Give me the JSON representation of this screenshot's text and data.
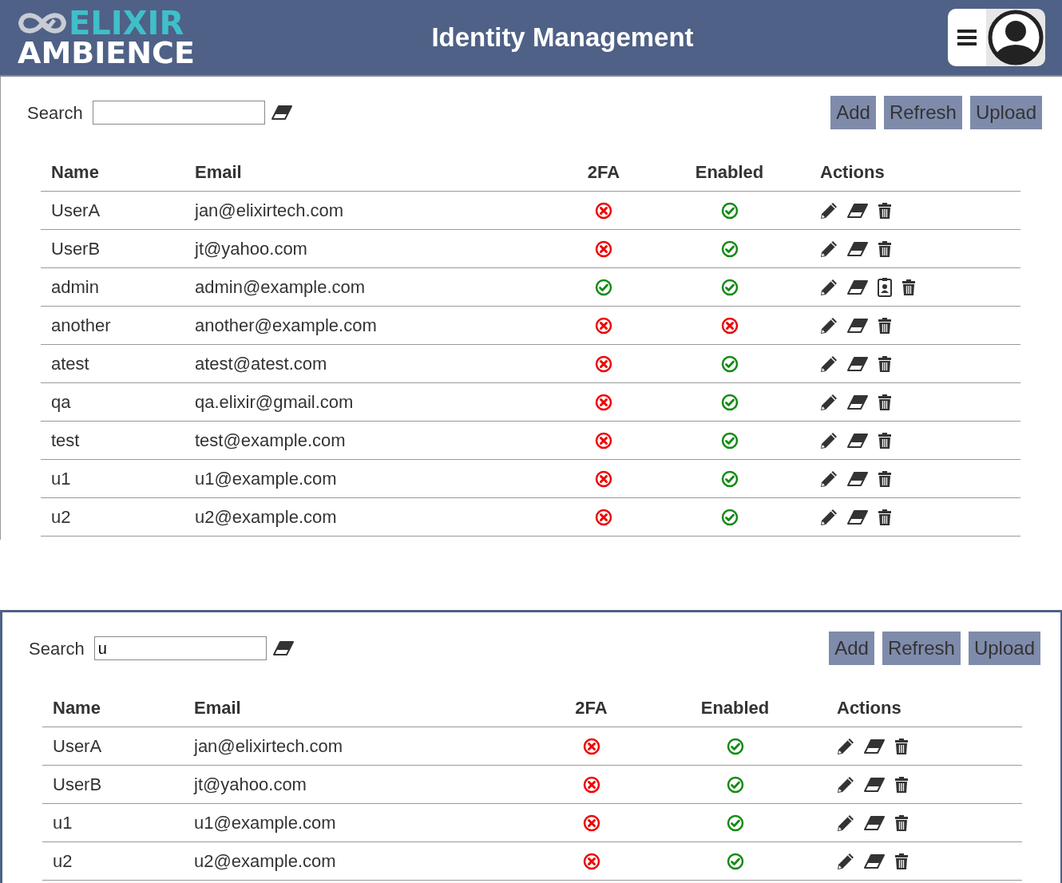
{
  "header": {
    "logo_top": "ELIXIR",
    "logo_bottom": "AMBIENCE",
    "title": "Identity Management"
  },
  "panels": [
    {
      "search": {
        "label": "Search"
      },
      "buttons": [
        "Add",
        "Refresh",
        "Upload"
      ],
      "table": {
        "columns": [
          "Name",
          "Email",
          "2FA",
          "Enabled",
          "Actions"
        ],
        "rows": [
          {
            "name": "UserA",
            "email": "jan@elixirtech.com",
            "twofa": false,
            "enabled": true,
            "actions": [
              {
                "kind": "edit"
              },
              {
                "kind": "erase"
              },
              {
                "kind": "delete"
              }
            ]
          },
          {
            "name": "UserB",
            "email": "jt@yahoo.com",
            "twofa": false,
            "enabled": true,
            "actions": [
              {
                "kind": "edit"
              },
              {
                "kind": "erase"
              },
              {
                "kind": "delete"
              }
            ]
          },
          {
            "name": "admin",
            "email": "admin@example.com",
            "twofa": true,
            "enabled": true,
            "actions": [
              {
                "kind": "edit"
              },
              {
                "kind": "erase"
              },
              {
                "kind": "badge"
              },
              {
                "kind": "delete"
              }
            ]
          },
          {
            "name": "another",
            "email": "another@example.com",
            "twofa": false,
            "enabled": false,
            "actions": [
              {
                "kind": "edit"
              },
              {
                "kind": "erase"
              },
              {
                "kind": "delete"
              }
            ]
          },
          {
            "name": "atest",
            "email": "atest@atest.com",
            "twofa": false,
            "enabled": true,
            "actions": [
              {
                "kind": "edit"
              },
              {
                "kind": "erase"
              },
              {
                "kind": "delete"
              }
            ]
          },
          {
            "name": "qa",
            "email": "qa.elixir@gmail.com",
            "twofa": false,
            "enabled": true,
            "actions": [
              {
                "kind": "edit"
              },
              {
                "kind": "erase"
              },
              {
                "kind": "delete"
              }
            ]
          },
          {
            "name": "test",
            "email": "test@example.com",
            "twofa": false,
            "enabled": true,
            "actions": [
              {
                "kind": "edit"
              },
              {
                "kind": "erase"
              },
              {
                "kind": "delete"
              }
            ]
          },
          {
            "name": "u1",
            "email": "u1@example.com",
            "twofa": false,
            "enabled": true,
            "actions": [
              {
                "kind": "edit"
              },
              {
                "kind": "erase"
              },
              {
                "kind": "delete"
              }
            ]
          },
          {
            "name": "u2",
            "email": "u2@example.com",
            "twofa": false,
            "enabled": true,
            "actions": [
              {
                "kind": "edit"
              },
              {
                "kind": "erase"
              },
              {
                "kind": "delete"
              }
            ]
          }
        ]
      }
    },
    {
      "search": {
        "label": "Search",
        "value": "u"
      },
      "buttons": [
        "Add",
        "Refresh",
        "Upload"
      ],
      "table": {
        "columns": [
          "Name",
          "Email",
          "2FA",
          "Enabled",
          "Actions"
        ],
        "rows": [
          {
            "name": "UserA",
            "email": "jan@elixirtech.com",
            "twofa": false,
            "enabled": true,
            "actions": [
              {
                "kind": "edit"
              },
              {
                "kind": "erase"
              },
              {
                "kind": "delete"
              }
            ]
          },
          {
            "name": "UserB",
            "email": "jt@yahoo.com",
            "twofa": false,
            "enabled": true,
            "actions": [
              {
                "kind": "edit"
              },
              {
                "kind": "erase"
              },
              {
                "kind": "delete"
              }
            ]
          },
          {
            "name": "u1",
            "email": "u1@example.com",
            "twofa": false,
            "enabled": true,
            "actions": [
              {
                "kind": "edit"
              },
              {
                "kind": "erase"
              },
              {
                "kind": "delete"
              }
            ]
          },
          {
            "name": "u2",
            "email": "u2@example.com",
            "twofa": false,
            "enabled": true,
            "actions": [
              {
                "kind": "edit"
              },
              {
                "kind": "erase"
              },
              {
                "kind": "delete"
              }
            ]
          }
        ]
      }
    }
  ]
}
